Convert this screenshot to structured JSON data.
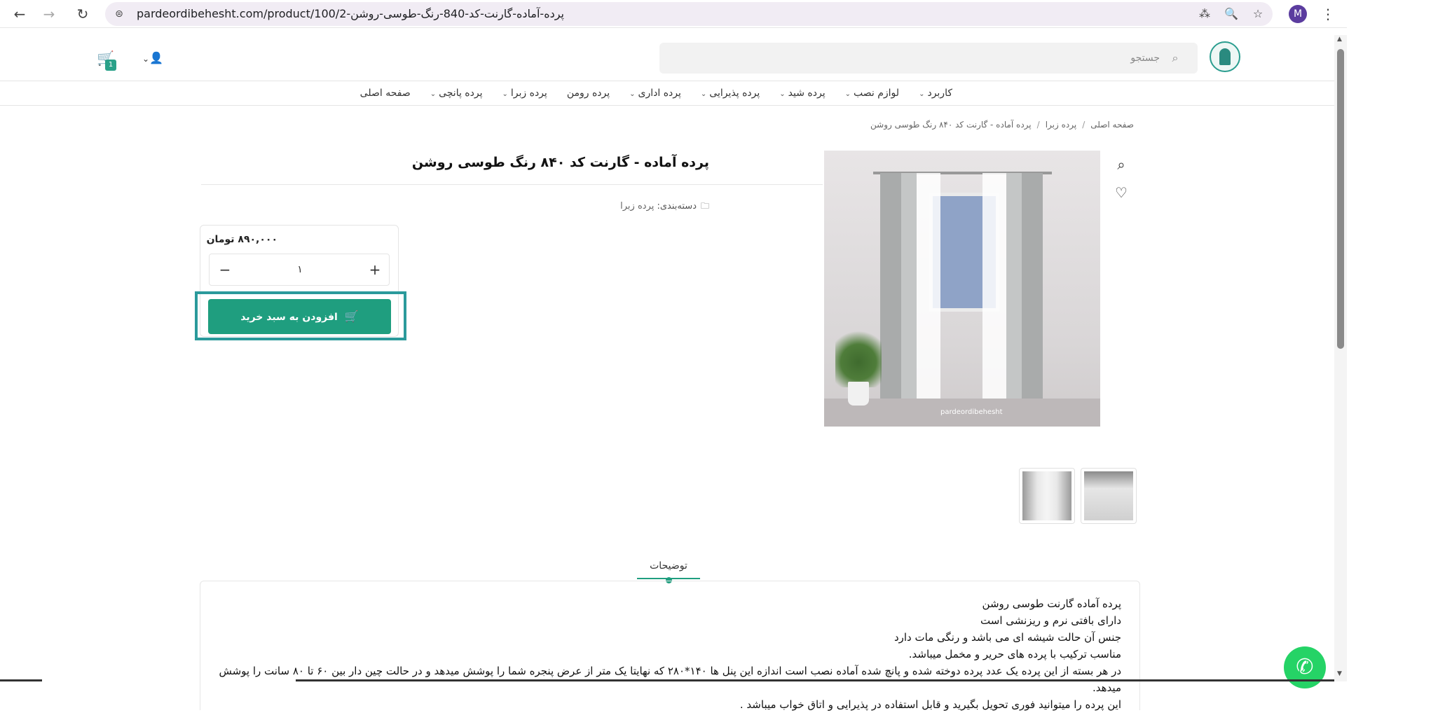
{
  "browser": {
    "url": "pardeordibehesht.com/product/100/2-پرده-آماده-گارنت-کد-840-رنگ-طوسی-روشن",
    "back_icon": "←",
    "forward_icon": "→",
    "reload_icon": "↻",
    "site_info_icon": "⊜",
    "translate_icon": "⁂",
    "zoom_icon": "🔍",
    "bookmark_icon": "☆",
    "profile_initial": "M",
    "menu_icon": "⋮"
  },
  "header": {
    "search_placeholder": "جستجو",
    "search_icon": "⌕",
    "user_icon": "👤",
    "user_chevron": "⌄",
    "cart_icon": "🛒",
    "cart_count": "1"
  },
  "nav": {
    "items": [
      {
        "label": "صفحه اصلی",
        "chevron": ""
      },
      {
        "label": "پرده پانچی",
        "chevron": "⌄"
      },
      {
        "label": "پرده زبرا",
        "chevron": "⌄"
      },
      {
        "label": "پرده رومن",
        "chevron": ""
      },
      {
        "label": "پرده اداری",
        "chevron": "⌄"
      },
      {
        "label": "پرده پذیرایی",
        "chevron": "⌄"
      },
      {
        "label": "پرده شید",
        "chevron": "⌄"
      },
      {
        "label": "لوازم نصب",
        "chevron": "⌄"
      },
      {
        "label": "کاربرد",
        "chevron": "⌄"
      }
    ]
  },
  "breadcrumb": {
    "home": "صفحه اصلی",
    "category": "پرده زبرا",
    "current": "پرده آماده - گارنت کد ۸۴۰ رنگ طوسی روشن",
    "separator": "/"
  },
  "product": {
    "title": "پرده آماده - گارنت کد ۸۴۰ رنگ طوسی روشن",
    "category_label": "دسته‌بندی:",
    "category_value": "پرده زبرا",
    "folder_icon": "🗀",
    "zoom_icon": "⌕",
    "wishlist_icon": "♡",
    "image_watermark": "pardeordibehesht",
    "price": "۸۹۰,۰۰۰ تومان",
    "quantity": "۱",
    "minus": "−",
    "plus": "+",
    "add_to_cart": "افزودن به سبد خرید",
    "add_cart_icon": "🛒"
  },
  "tabs": {
    "description": "توضیحات"
  },
  "description": {
    "lines": [
      "پرده آماده گارنت طوسی روشن",
      "دارای بافتی نرم و ریزنشی است",
      "جنس آن حالت شیشه ای می باشد و رنگی مات دارد",
      "مناسب ترکیب با پرده های حریر و مخمل میباشد.",
      "در هر بسته از این پرده یک عدد پرده دوخته شده و پانچ شده آماده نصب است اندازه این پنل ها ۱۴۰*۲۸۰ که نهایتا یک متر از عرض پنجره شما را پوشش میدهد و در حالت چین دار بین ۶۰ تا ۸۰ سانت را پوشش میدهد.",
      "این پرده را میتوانید فوری تحویل بگیرید و قابل استفاده در پذیرایی و اتاق خواب میباشد ."
    ]
  },
  "whatsapp_icon": "✆",
  "colors": {
    "accent": "#1f9e7f",
    "highlight": "#2b9a9b",
    "whatsapp": "#25d366"
  }
}
